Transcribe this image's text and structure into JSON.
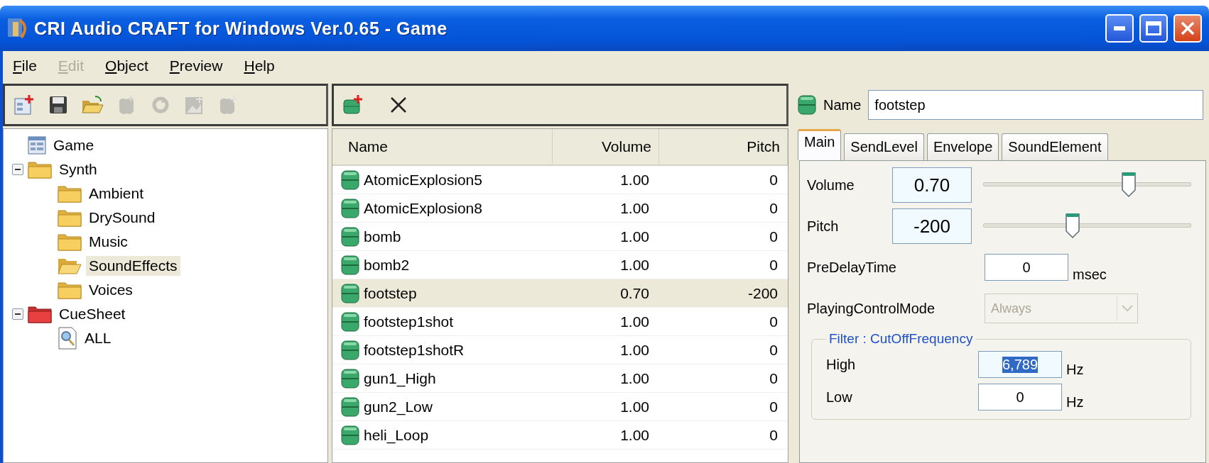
{
  "window": {
    "title": "CRI Audio CRAFT for Windows Ver.0.65 - Game"
  },
  "menu": [
    {
      "label": "File",
      "disabled": false
    },
    {
      "label": "Edit",
      "disabled": true
    },
    {
      "label": "Object",
      "disabled": false
    },
    {
      "label": "Preview",
      "disabled": false
    },
    {
      "label": "Help",
      "disabled": false
    }
  ],
  "tree_toolbar": [
    {
      "kind": "new",
      "disabled": false
    },
    {
      "kind": "save",
      "disabled": false
    },
    {
      "kind": "open",
      "disabled": false
    },
    {
      "kind": "cue",
      "disabled": true
    },
    {
      "kind": "refresh",
      "disabled": true
    },
    {
      "kind": "add-image",
      "disabled": true
    },
    {
      "kind": "add-cue",
      "disabled": true
    }
  ],
  "list_toolbar": [
    {
      "kind": "new-sound",
      "disabled": false
    },
    {
      "kind": "delete",
      "disabled": false
    }
  ],
  "tree": [
    {
      "label": "Game",
      "kind": "project",
      "selected": false,
      "children": [
        {
          "label": "Synth",
          "kind": "folder",
          "expanded": true,
          "selected": false,
          "children": [
            {
              "label": "Ambient",
              "kind": "folder",
              "selected": false
            },
            {
              "label": "DrySound",
              "kind": "folder",
              "selected": false
            },
            {
              "label": "Music",
              "kind": "folder",
              "selected": false
            },
            {
              "label": "SoundEffects",
              "kind": "folder",
              "selected": true
            },
            {
              "label": "Voices",
              "kind": "folder",
              "selected": false
            }
          ]
        },
        {
          "label": "CueSheet",
          "kind": "cuesheet",
          "expanded": true,
          "selected": false,
          "children": [
            {
              "label": "ALL",
              "kind": "query",
              "selected": false
            }
          ]
        }
      ]
    }
  ],
  "table": {
    "columns": [
      "Name",
      "Volume",
      "Pitch"
    ],
    "rows": [
      {
        "name": "AtomicExplosion5",
        "volume": "1.00",
        "pitch": "0",
        "selected": false
      },
      {
        "name": "AtomicExplosion8",
        "volume": "1.00",
        "pitch": "0",
        "selected": false
      },
      {
        "name": "bomb",
        "volume": "1.00",
        "pitch": "0",
        "selected": false
      },
      {
        "name": "bomb2",
        "volume": "1.00",
        "pitch": "0",
        "selected": false
      },
      {
        "name": "footstep",
        "volume": "0.70",
        "pitch": "-200",
        "selected": true
      },
      {
        "name": "footstep1shot",
        "volume": "1.00",
        "pitch": "0",
        "selected": false
      },
      {
        "name": "footstep1shotR",
        "volume": "1.00",
        "pitch": "0",
        "selected": false
      },
      {
        "name": "gun1_High",
        "volume": "1.00",
        "pitch": "0",
        "selected": false
      },
      {
        "name": "gun2_Low",
        "volume": "1.00",
        "pitch": "0",
        "selected": false
      },
      {
        "name": "heli_Loop",
        "volume": "1.00",
        "pitch": "0",
        "selected": false
      }
    ]
  },
  "properties": {
    "name_label": "Name",
    "name_value": "footstep",
    "tabs": [
      {
        "label": "Main",
        "selected": true
      },
      {
        "label": "SendLevel",
        "selected": false
      },
      {
        "label": "Envelope",
        "selected": false
      },
      {
        "label": "SoundElement",
        "selected": false
      }
    ],
    "sliders": [
      {
        "label": "Volume",
        "value": "0.70",
        "level": 0.7
      },
      {
        "label": "Pitch",
        "value": "-200",
        "level": 0.43
      }
    ],
    "predelay": {
      "label": "PreDelayTime",
      "value": "0",
      "unit": "msec"
    },
    "playing_mode": {
      "label": "PlayingControlMode",
      "value": "Always",
      "disabled": true
    },
    "filter": {
      "title": "Filter : CutOffFrequency",
      "fields": [
        {
          "label": "High",
          "value": "6,789",
          "unit": "Hz",
          "text_selected": true
        },
        {
          "label": "Low",
          "value": "0",
          "unit": "Hz",
          "text_selected": false
        }
      ]
    }
  }
}
